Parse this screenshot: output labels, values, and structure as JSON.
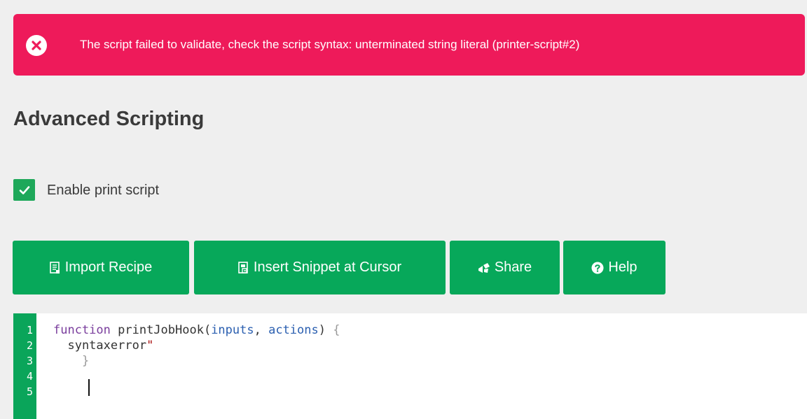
{
  "colors": {
    "error_banner": "#ee1a5a",
    "button_green": "#07a85a",
    "gutter_green": "#0aa55a",
    "checkbox_green": "#1ea85a",
    "page_background": "#efefef"
  },
  "error": {
    "icon": "x-circle-icon",
    "message": "The script failed to validate, check the script syntax: unterminated string literal (printer-script#2)"
  },
  "page_title": "Advanced Scripting",
  "enable_checkbox": {
    "label": "Enable print script",
    "checked": true
  },
  "toolbar": {
    "import_label": "Import Recipe",
    "import_icon": "document-import-icon",
    "snippet_label": "Insert Snippet at Cursor",
    "snippet_icon": "snippet-insert-icon",
    "share_label": "Share",
    "share_icon": "share-icon",
    "help_label": "Help",
    "help_icon": "question-circle-icon"
  },
  "editor": {
    "line_numbers": [
      "1",
      "2",
      "3",
      "4",
      "5"
    ],
    "line1": {
      "kw_function": "function",
      "fn_name": " printJobHook(",
      "param_inputs": "inputs",
      "sep": ", ",
      "param_actions": "actions",
      "close": ") ",
      "brace": "{"
    },
    "line2": {
      "text": "  syntaxerror",
      "quote": "\""
    },
    "line3": {
      "brace": "    }"
    }
  }
}
